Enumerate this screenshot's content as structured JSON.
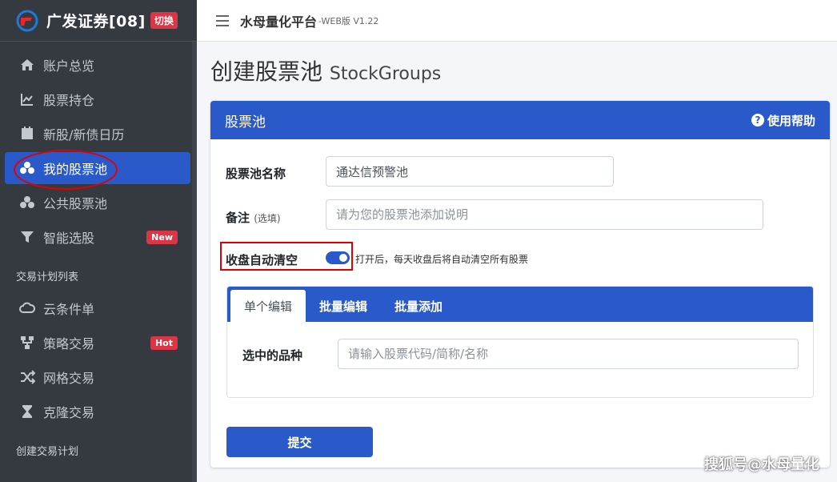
{
  "brand": {
    "title": "广发证券[08]",
    "badge": "切换",
    "accent": "#2a5ac9"
  },
  "sidebar": {
    "items": [
      {
        "label": "账户总览",
        "icon": "home-icon"
      },
      {
        "label": "股票持仓",
        "icon": "line-chart-icon"
      },
      {
        "label": "新股/新债日历",
        "icon": "calendar-icon"
      },
      {
        "label": "我的股票池",
        "icon": "cubes-icon",
        "active": true
      },
      {
        "label": "公共股票池",
        "icon": "cubes-icon"
      },
      {
        "label": "智能选股",
        "icon": "filter-icon",
        "badge": "New"
      }
    ],
    "section2_header": "交易计划列表",
    "section2_items": [
      {
        "label": "云条件单",
        "icon": "cloud-icon"
      },
      {
        "label": "策略交易",
        "icon": "sitemap-icon",
        "badge": "Hot"
      },
      {
        "label": "网格交易",
        "icon": "random-icon"
      },
      {
        "label": "克隆交易",
        "icon": "hourglass-icon"
      }
    ],
    "section3_header": "创建交易计划"
  },
  "topbar": {
    "title": "水母量化平台",
    "version": "-WEB版 V1.22"
  },
  "page": {
    "title": "创建股票池",
    "title_en": "StockGroups"
  },
  "card": {
    "title": "股票池",
    "help": "使用帮助",
    "name_label": "股票池名称",
    "name_value": "通达信预警池",
    "note_label": "备注",
    "note_hint": "(选填)",
    "note_placeholder": "请为您的股票池添加说明",
    "switch_label": "收盘自动清空",
    "switch_on": true,
    "switch_help": "打开后，每天收盘后将自动清空所有股票",
    "tabs": [
      "单个编辑",
      "批量编辑",
      "批量添加"
    ],
    "symbol_label": "选中的品种",
    "symbol_placeholder": "请输入股票代码/简称/名称",
    "submit": "提交"
  },
  "watermark": "搜狐号@水母量化"
}
